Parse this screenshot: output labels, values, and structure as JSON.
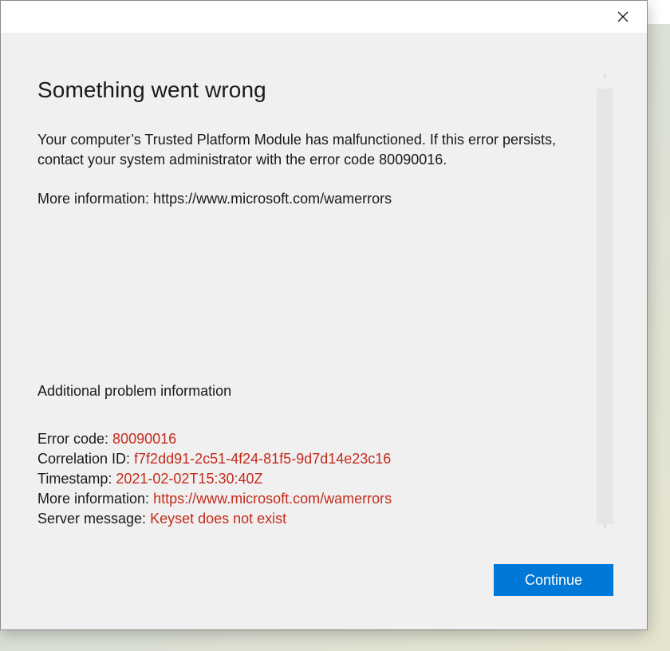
{
  "dialog": {
    "heading": "Something went wrong",
    "message": "Your computer’s Trusted Platform Module has malfunctioned. If this error persists, contact your system administrator with the error code 80090016.",
    "more_info": "More information: https://www.microsoft.com/wamerrors",
    "additional_heading": "Additional problem information",
    "details": {
      "error_code_label": "Error code: ",
      "error_code_value": "80090016",
      "correlation_label": "Correlation ID: ",
      "correlation_value": "f7f2dd91-2c51-4f24-81f5-9d7d14e23c16",
      "timestamp_label": "Timestamp: ",
      "timestamp_value": "2021-02-02T15:30:40Z",
      "more_info_label": "More information: ",
      "more_info_value": "https://www.microsoft.com/wamerrors",
      "server_message_label": "Server message: ",
      "server_message_value": "Keyset does not exist"
    },
    "continue_label": "Continue"
  },
  "icons": {
    "close": "close-icon",
    "scroll_up": "scroll-up-icon",
    "scroll_down": "scroll-down-icon"
  },
  "colors": {
    "accent": "#0078d7",
    "error_red": "#c42b1c",
    "dialog_bg": "#f0f0f0",
    "titlebar_bg": "#ffffff"
  }
}
